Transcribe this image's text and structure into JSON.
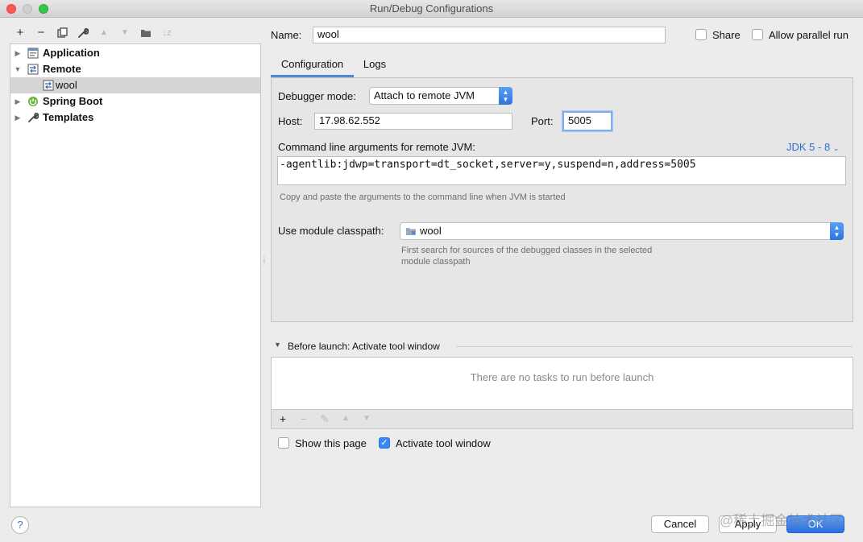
{
  "window": {
    "title": "Run/Debug Configurations"
  },
  "left_toolbar": {
    "add": "+",
    "remove": "−",
    "copy": "⧉",
    "edit": "🔧",
    "up": "▲",
    "down": "▼",
    "folder": "📁",
    "sort": "↓z"
  },
  "tree": {
    "items": [
      {
        "label": "Application"
      },
      {
        "label": "Remote"
      },
      {
        "label": "wool"
      },
      {
        "label": "Spring Boot"
      },
      {
        "label": "Templates"
      }
    ]
  },
  "name_row": {
    "label": "Name:",
    "value": "wool",
    "share_label": "Share",
    "parallel_label": "Allow parallel run"
  },
  "tabs": [
    {
      "label": "Configuration"
    },
    {
      "label": "Logs"
    }
  ],
  "config": {
    "debugger_mode_label": "Debugger mode:",
    "debugger_mode_value": "Attach to remote JVM",
    "host_label": "Host:",
    "host_value": "17.98.62.552",
    "port_label": "Port:",
    "port_value": "5005",
    "cmd_label": "Command line arguments for remote JVM:",
    "jdk_link": "JDK 5 - 8",
    "cmd_value": "-agentlib:jdwp=transport=dt_socket,server=y,suspend=n,address=5005",
    "cmd_hint": "Copy and paste the arguments to the command line when JVM is started",
    "module_label": "Use module classpath:",
    "module_value": "wool",
    "module_hint_1": "First search for sources of the debugged classes in the selected",
    "module_hint_2": "module classpath"
  },
  "before_launch": {
    "title": "Before launch: Activate tool window",
    "empty_text": "There are no tasks to run before launch",
    "toolbar": {
      "add": "+",
      "remove": "−",
      "edit": "✎",
      "up": "▲",
      "down": "▼"
    }
  },
  "options": {
    "show_page_label": "Show this page",
    "activate_label": "Activate tool window"
  },
  "buttons": {
    "help": "?",
    "cancel": "Cancel",
    "apply": "Apply",
    "ok": "OK"
  },
  "watermark": "@稀土掘金技术社区",
  "colors": {
    "accent": "#3b87f7",
    "link": "#2f6fd1"
  }
}
